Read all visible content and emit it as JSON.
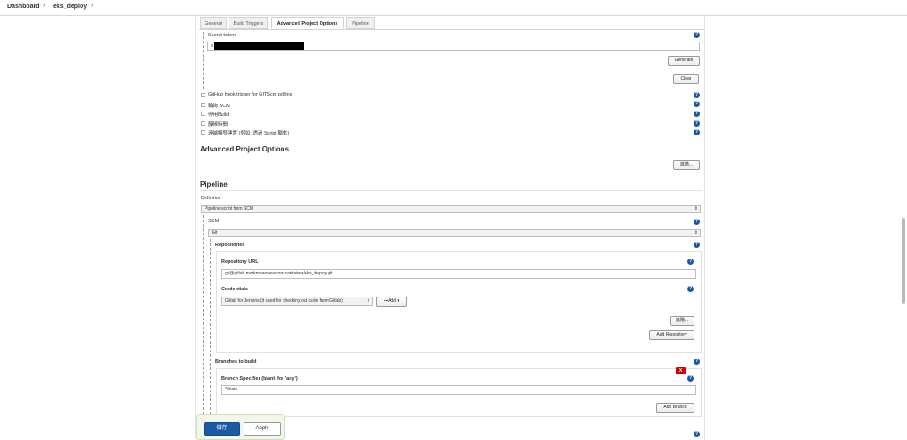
{
  "breadcrumb": {
    "dashboard": "Dashboard",
    "sep1": "›",
    "job": "eks_deploy",
    "sep2": "›"
  },
  "tabs": {
    "general": "General",
    "build_triggers": "Build Triggers",
    "advanced": "Advanced Project Options",
    "pipeline": "Pipeline"
  },
  "triggers": {
    "secret_token_label": "Secret token",
    "secret_token_prefix": "a",
    "generate_label": "Generate",
    "clear_label": "Clear",
    "options": [
      "GitHub hook trigger for GITScm polling",
      "輪詢 SCM",
      "停用Build",
      "靜候時間",
      "遠端觸發建置 (例如: 透過 Script 腳本)"
    ]
  },
  "advanced": {
    "heading": "Advanced Project Options",
    "button_label": "進階..."
  },
  "pipeline": {
    "heading": "Pipeline",
    "definition_label": "Definition",
    "definition_value": "Pipeline script from SCM",
    "scm_label": "SCM",
    "scm_value": "Git",
    "repositories_label": "Repositories",
    "repo_url_label": "Repository URL",
    "repo_url_value": "git@gitlab.markmewmew.com:container/eks_deploy.git",
    "credentials_label": "Credentials",
    "credentials_value": "Gitlab for Jenkins (it used for checking out code from Gitlab)",
    "add_label": "⊶Add ▾",
    "advanced_label": "進階...",
    "add_repository_label": "Add Repository",
    "branches_label": "Branches to build",
    "delete_label": "X",
    "branch_specifier_label": "Branch Specifier (blank for 'any')",
    "branch_specifier_value": "*/main",
    "add_branch_label": "Add Branch"
  },
  "footer": {
    "save_label": "儲存",
    "apply_label": "Apply"
  },
  "help_glyph": "?",
  "colors": {
    "save": "#1c5aa6",
    "help": "#1c5aa6",
    "delete": "#cc0000"
  }
}
